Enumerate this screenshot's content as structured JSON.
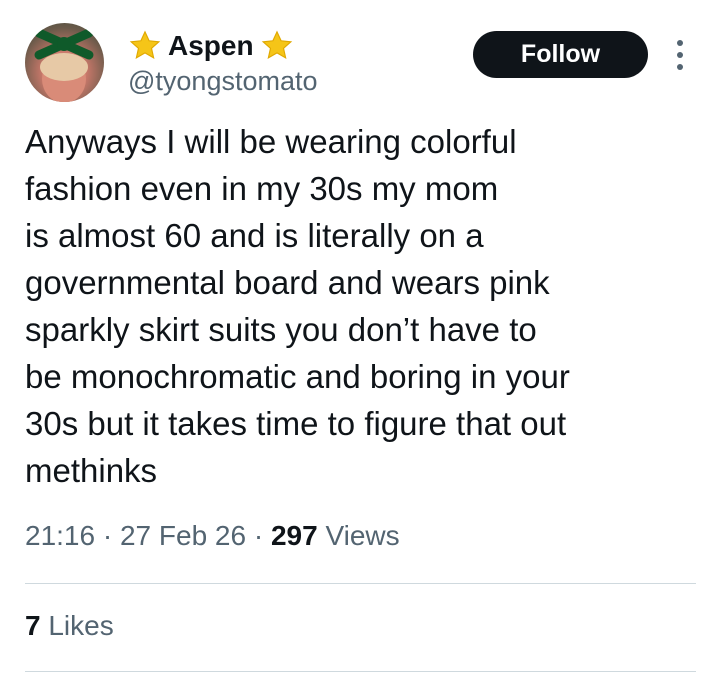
{
  "author": {
    "display_name": "Aspen",
    "name_emoji_left": "star-emoji",
    "name_emoji_right": "star-emoji",
    "handle": "@tyongstomato"
  },
  "actions": {
    "follow_label": "Follow",
    "more_icon": "more-vertical-icon"
  },
  "tweet": {
    "lines": [
      "Anyways I will be wearing colorful",
      "fashion even in my 30s my mom",
      "is almost 60 and is literally on a",
      "governmental board and wears pink",
      "sparkly skirt suits you don’t have to",
      "be monochromatic and boring in your",
      "30s but it takes time to figure that out",
      "methinks"
    ]
  },
  "meta": {
    "time": "21:16",
    "separator": " · ",
    "date": "27 Feb 26",
    "views_count": "297",
    "views_label": " Views"
  },
  "engagement": {
    "likes_count": "7",
    "likes_label": " Likes"
  },
  "colors": {
    "text": "#0f1419",
    "secondary": "#536471",
    "button_bg": "#0f1419",
    "divider": "#cfd9de",
    "star": "#f5c518"
  }
}
